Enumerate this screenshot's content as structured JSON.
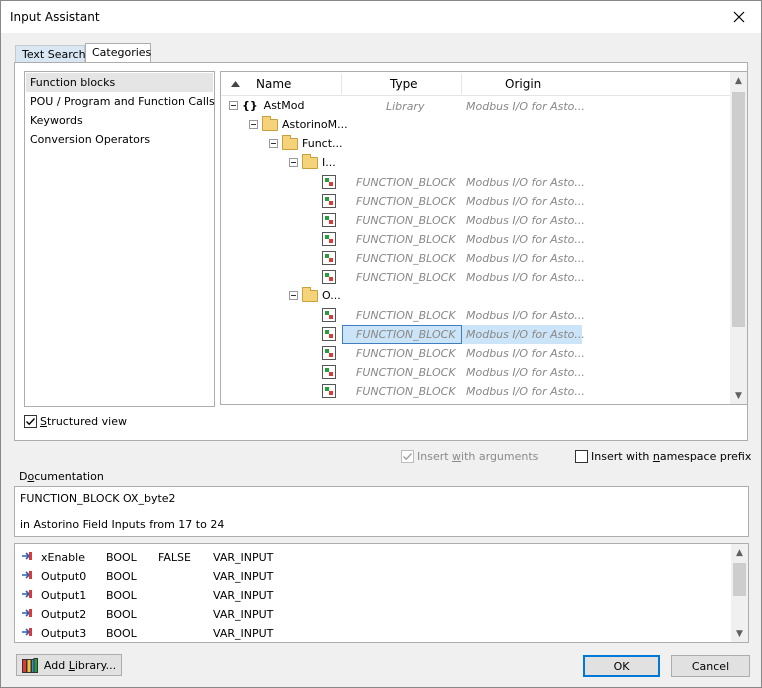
{
  "window": {
    "title": "Input Assistant"
  },
  "tabs": [
    {
      "label": "Text Search",
      "active": false
    },
    {
      "label": "Categories",
      "active": true
    }
  ],
  "categories": [
    {
      "label": "Function blocks",
      "selected": true
    },
    {
      "label": "POU / Program and Function Calls",
      "selected": false
    },
    {
      "label": "Keywords",
      "selected": false
    },
    {
      "label": "Conversion Operators",
      "selected": false
    }
  ],
  "structured_view": {
    "label_prefix": "",
    "label_underlined": "S",
    "label_rest": "tructured view",
    "checked": true
  },
  "tree": {
    "columns": {
      "name": "Name",
      "type": "Type",
      "origin": "Origin"
    },
    "rows": [
      {
        "kind": "lib",
        "name": "AstMod",
        "type": "Library",
        "origin": "Modbus I/O for Asto..."
      },
      {
        "kind": "folder",
        "name": "AstorinoM...",
        "type": "",
        "origin": ""
      },
      {
        "kind": "folder",
        "name": "Funct...",
        "type": "",
        "origin": ""
      },
      {
        "kind": "folder",
        "name": "I...",
        "type": "",
        "origin": ""
      },
      {
        "kind": "fb",
        "name": "",
        "type": "FUNCTION_BLOCK",
        "origin": "Modbus I/O for Asto..."
      },
      {
        "kind": "fb",
        "name": "",
        "type": "FUNCTION_BLOCK",
        "origin": "Modbus I/O for Asto..."
      },
      {
        "kind": "fb",
        "name": "",
        "type": "FUNCTION_BLOCK",
        "origin": "Modbus I/O for Asto..."
      },
      {
        "kind": "fb",
        "name": "",
        "type": "FUNCTION_BLOCK",
        "origin": "Modbus I/O for Asto..."
      },
      {
        "kind": "fb",
        "name": "",
        "type": "FUNCTION_BLOCK",
        "origin": "Modbus I/O for Asto..."
      },
      {
        "kind": "fb",
        "name": "",
        "type": "FUNCTION_BLOCK",
        "origin": "Modbus I/O for Asto..."
      },
      {
        "kind": "folder",
        "name": "O...",
        "type": "",
        "origin": ""
      },
      {
        "kind": "fb",
        "name": "",
        "type": "FUNCTION_BLOCK",
        "origin": "Modbus I/O for Asto..."
      },
      {
        "kind": "fb",
        "name": "",
        "type": "FUNCTION_BLOCK",
        "origin": "Modbus I/O for Asto...",
        "selected": true
      },
      {
        "kind": "fb",
        "name": "",
        "type": "FUNCTION_BLOCK",
        "origin": "Modbus I/O for Asto..."
      },
      {
        "kind": "fb",
        "name": "",
        "type": "FUNCTION_BLOCK",
        "origin": "Modbus I/O for Asto..."
      },
      {
        "kind": "fb",
        "name": "",
        "type": "FUNCTION_BLOCK",
        "origin": "Modbus I/O for Asto..."
      }
    ]
  },
  "insert_with_arguments": {
    "label_prefix": "Insert ",
    "label_underlined": "w",
    "label_rest": "ith arguments",
    "checked": true,
    "disabled": true
  },
  "insert_namespace": {
    "label_prefix": "Insert with ",
    "label_underlined": "n",
    "label_rest": "amespace prefix",
    "checked": false
  },
  "documentation": {
    "label_prefix": "D",
    "label_underlined": "o",
    "label_rest": "cumentation",
    "line1": "FUNCTION_BLOCK OX_byte2",
    "line2": "in Astorino Field Inputs from 17 to 24"
  },
  "variables": [
    {
      "name": "xEnable",
      "type": "BOOL",
      "init": "FALSE",
      "scope": "VAR_INPUT"
    },
    {
      "name": "Output0",
      "type": "BOOL",
      "init": "",
      "scope": "VAR_INPUT"
    },
    {
      "name": "Output1",
      "type": "BOOL",
      "init": "",
      "scope": "VAR_INPUT"
    },
    {
      "name": "Output2",
      "type": "BOOL",
      "init": "",
      "scope": "VAR_INPUT"
    },
    {
      "name": "Output3",
      "type": "BOOL",
      "init": "",
      "scope": "VAR_INPUT"
    }
  ],
  "buttons": {
    "add_library_prefix": "Add ",
    "add_library_underlined": "L",
    "add_library_rest": "ibrary...",
    "ok": "OK",
    "cancel": "Cancel"
  },
  "icons": {
    "close": "close-icon",
    "sort": "sort-asc-icon",
    "library": "library-icon",
    "variable": "input-variable-icon"
  }
}
